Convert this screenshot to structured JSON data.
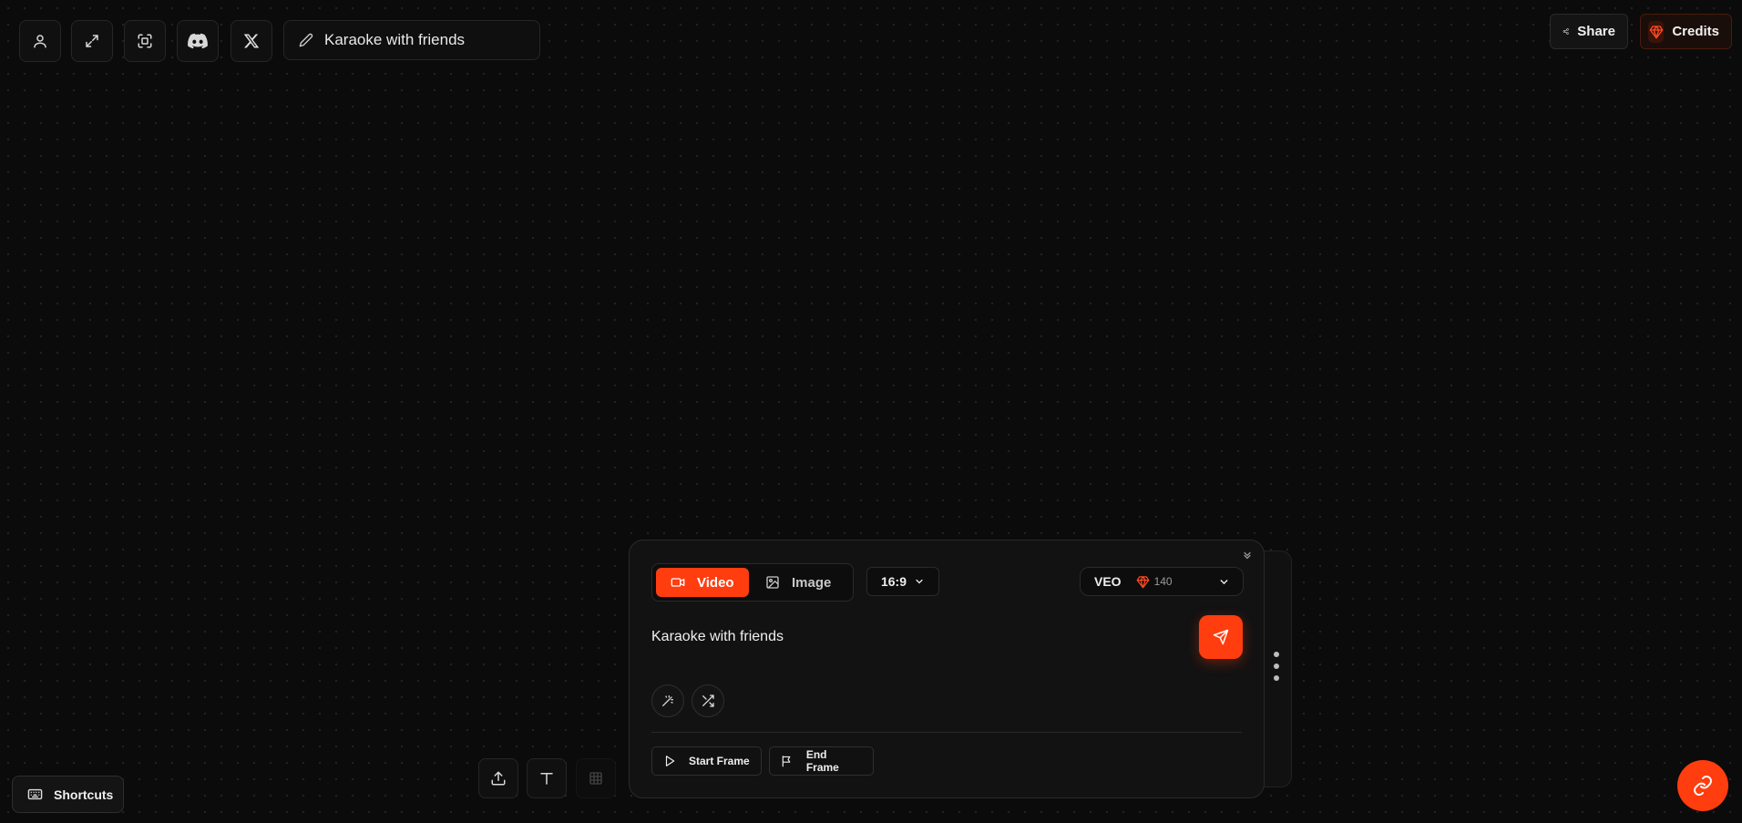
{
  "header": {
    "project_title": "Karaoke with friends",
    "share_label": "Share",
    "credits_label": "Credits"
  },
  "composer": {
    "modes": [
      {
        "label": "Video",
        "active": true
      },
      {
        "label": "Image",
        "active": false
      }
    ],
    "aspect_ratio": "16:9",
    "model": {
      "name": "VEO",
      "credits": "140"
    },
    "prompt": "Karaoke with friends",
    "start_frame_label": "Start Frame",
    "end_frame_label": "End Frame"
  },
  "footer": {
    "shortcuts_label": "Shortcuts"
  },
  "colors": {
    "accent": "#ff3d0f",
    "background": "#0b0b0b",
    "panel": "#121212"
  },
  "icons": [
    "user-icon",
    "expand-icon",
    "focus-icon",
    "discord-icon",
    "x-logo-icon",
    "pencil-icon",
    "share-icon",
    "gem-icon",
    "chevrons-down-icon",
    "video-icon",
    "image-icon",
    "chevron-down-icon",
    "send-icon",
    "magic-wand-icon",
    "shuffle-icon",
    "play-icon",
    "flag-icon",
    "upload-icon",
    "text-icon",
    "grid-icon",
    "keyboard-icon",
    "link-icon"
  ]
}
